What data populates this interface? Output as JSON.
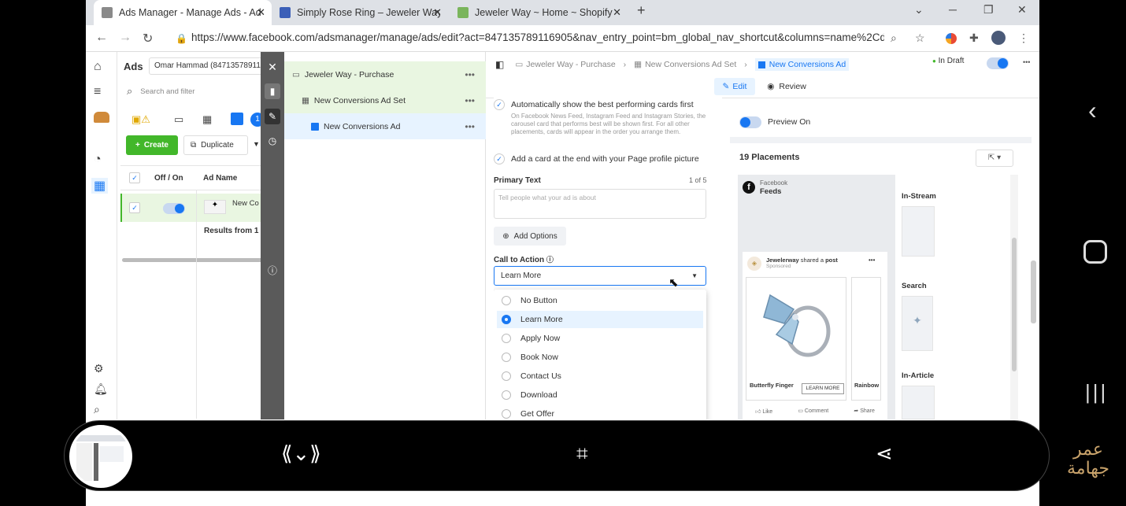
{
  "browser": {
    "tabs": [
      {
        "title": "Ads Manager - Manage Ads - Ad",
        "close": "✕",
        "active": true
      },
      {
        "title": "Simply Rose Ring – Jeweler Way",
        "close": "✕"
      },
      {
        "title": "Jeweler Way ~ Home ~ Shopify",
        "close": "✕"
      }
    ],
    "new_tab": "+",
    "url": "https://www.facebook.com/adsmanager/manage/ads/edit?act=847135789116905&nav_entry_point=bm_global_nav_shortcut&columns=name%2Cd..."
  },
  "ads_panel": {
    "title": "Ads",
    "account": "Omar Hammad (84713578911",
    "search_placeholder": "Search and filter",
    "create_label": "Create",
    "duplicate_label": "Duplicate",
    "columns": {
      "toggle": "Off / On",
      "name": "Ad Name"
    },
    "row_name": "New Co",
    "results": "Results from 1 a",
    "badge": "1"
  },
  "tree": {
    "items": [
      {
        "label": "Jeweler Way - Purchase",
        "more": "•••"
      },
      {
        "label": "New Conversions Ad Set",
        "more": "•••"
      },
      {
        "label": "New Conversions Ad",
        "more": "•••"
      }
    ]
  },
  "editor": {
    "crumbs": [
      "Jeweler Way - Purchase",
      "New Conversions Ad Set",
      "New Conversions Ad"
    ],
    "status": "In Draft",
    "more": "•••",
    "edit_label": "Edit",
    "review_label": "Review",
    "auto_cards": {
      "label": "Automatically show the best performing cards first",
      "desc": "On Facebook News Feed, Instagram Feed and Instagram Stories, the carousel card that performs best will be shown first. For all other placements, cards will appear in the order you arrange them."
    },
    "end_card": "Add a card at the end with your Page profile picture",
    "primary_text_label": "Primary Text",
    "primary_text_count": "1 of 5",
    "primary_text_placeholder": "Tell people what your ad is about",
    "add_options": "Add Options",
    "cta_label": "Call to Action",
    "cta_value": "Learn More",
    "cta_options": [
      {
        "label": "No Button",
        "selected": false
      },
      {
        "label": "Learn More",
        "selected": true
      },
      {
        "label": "Apply Now",
        "selected": false
      },
      {
        "label": "Book Now",
        "selected": false
      },
      {
        "label": "Contact Us",
        "selected": false
      },
      {
        "label": "Download",
        "selected": false
      },
      {
        "label": "Get Offer",
        "selected": false
      }
    ]
  },
  "preview": {
    "toggle_label": "Preview On",
    "placements": "19 Placements",
    "fb_label": "Facebook",
    "feeds_label": "Feeds",
    "post_page": "Jewelerway",
    "post_shared": "shared a",
    "post_link": "post",
    "sponsored": "Sponsored",
    "card1_title": "Butterfly Finger",
    "card1_cta": "LEARN MORE",
    "card2_title": "Rainbow",
    "actions": [
      "Like",
      "Comment",
      "Share"
    ],
    "sections": [
      "In-Stream",
      "Search",
      "In-Article"
    ]
  },
  "watermark": {
    "line1": "عمر",
    "line2": "جهامة"
  },
  "colors": {
    "accent": "#1877f2",
    "create": "#42b72a",
    "tree_selected": "#e7f3ff",
    "tree_group": "#e9f6e1"
  }
}
